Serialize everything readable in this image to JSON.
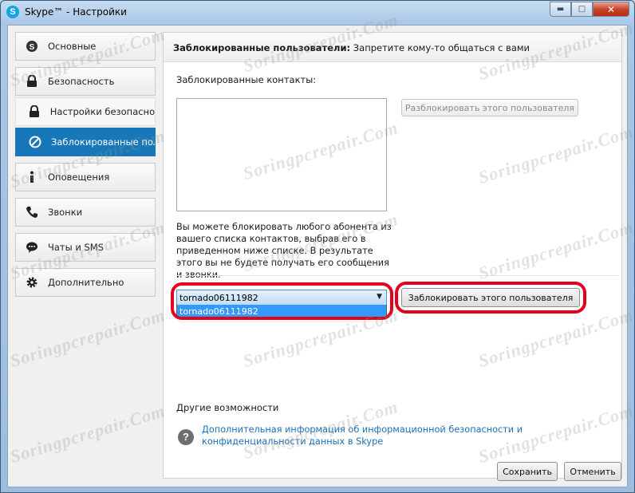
{
  "window": {
    "title": "Skype™ - Настройки",
    "app_icon": "S",
    "minimize": "▬",
    "maximize": "□",
    "close": "✕"
  },
  "sidebar": {
    "items": [
      {
        "label": "Основные",
        "icon": "skype-icon"
      },
      {
        "label": "Безопасность",
        "icon": "lock-icon"
      },
      {
        "label": "Настройки безопасно...",
        "icon": "lock-icon"
      },
      {
        "label": "Заблокированные пол...",
        "icon": "blocked-icon"
      },
      {
        "label": "Оповещения",
        "icon": "info-icon"
      },
      {
        "label": "Звонки",
        "icon": "phone-icon"
      },
      {
        "label": "Чаты и SMS",
        "icon": "chat-icon"
      },
      {
        "label": "Дополнительно",
        "icon": "gear-icon"
      }
    ],
    "active_index": 3
  },
  "panel": {
    "header_bold": "Заблокированные пользователи:",
    "header_rest": " Запретите кому-то общаться с вами",
    "contacts_label": "Заблокированные контакты:",
    "unblock_button": "Разблокировать этого пользователя",
    "description": "Вы можете блокировать любого абонента из вашего списка контактов, выбрав его в приведенном ниже списке. В результате этого вы не будете получать его сообщения и звонки.",
    "combo_value": "tornado06111982",
    "dropdown_options": [
      "tornado06111982"
    ],
    "block_button": "Заблокировать этого пользователя",
    "other_label": "Другие возможности",
    "help_link": "Дополнительная информация об информационной безопасности и конфиденциальности данных в Skype"
  },
  "footer": {
    "save": "Сохранить",
    "cancel": "Отменить"
  },
  "watermark": "Soringpcrepair.Com",
  "colors": {
    "active_nav": "#1877b8",
    "link": "#1b6fb7",
    "highlight_oval": "#e3001c",
    "dropdown_selection": "#3399ff"
  }
}
